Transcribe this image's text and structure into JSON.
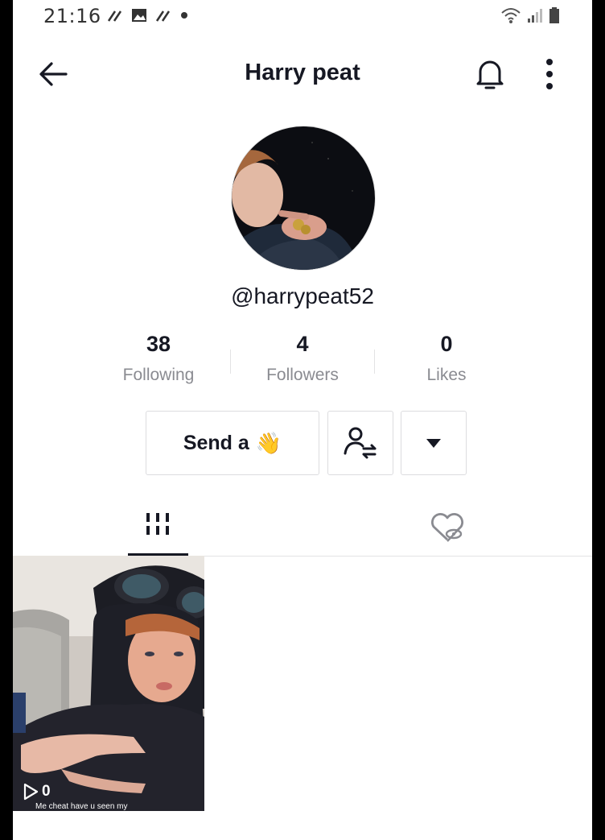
{
  "status_bar": {
    "time": "21:16"
  },
  "header": {
    "title": "Harry peat",
    "back_icon": "arrow-left-icon",
    "bell_icon": "bell-icon",
    "more_icon": "more-vertical-icon"
  },
  "profile": {
    "username": "@harrypeat52",
    "stats": [
      {
        "value": "38",
        "label": "Following"
      },
      {
        "value": "4",
        "label": "Followers"
      },
      {
        "value": "0",
        "label": "Likes"
      }
    ]
  },
  "actions": {
    "send_label": "Send a",
    "send_emoji": "👋",
    "friends_icon": "add-friend-icon",
    "dropdown_icon": "caret-down-icon"
  },
  "tabs": {
    "videos_icon": "grid-icon",
    "liked_icon": "hidden-heart-icon"
  },
  "videos": [
    {
      "play_count": "0",
      "caption": "Me cheat have u seen my"
    }
  ]
}
